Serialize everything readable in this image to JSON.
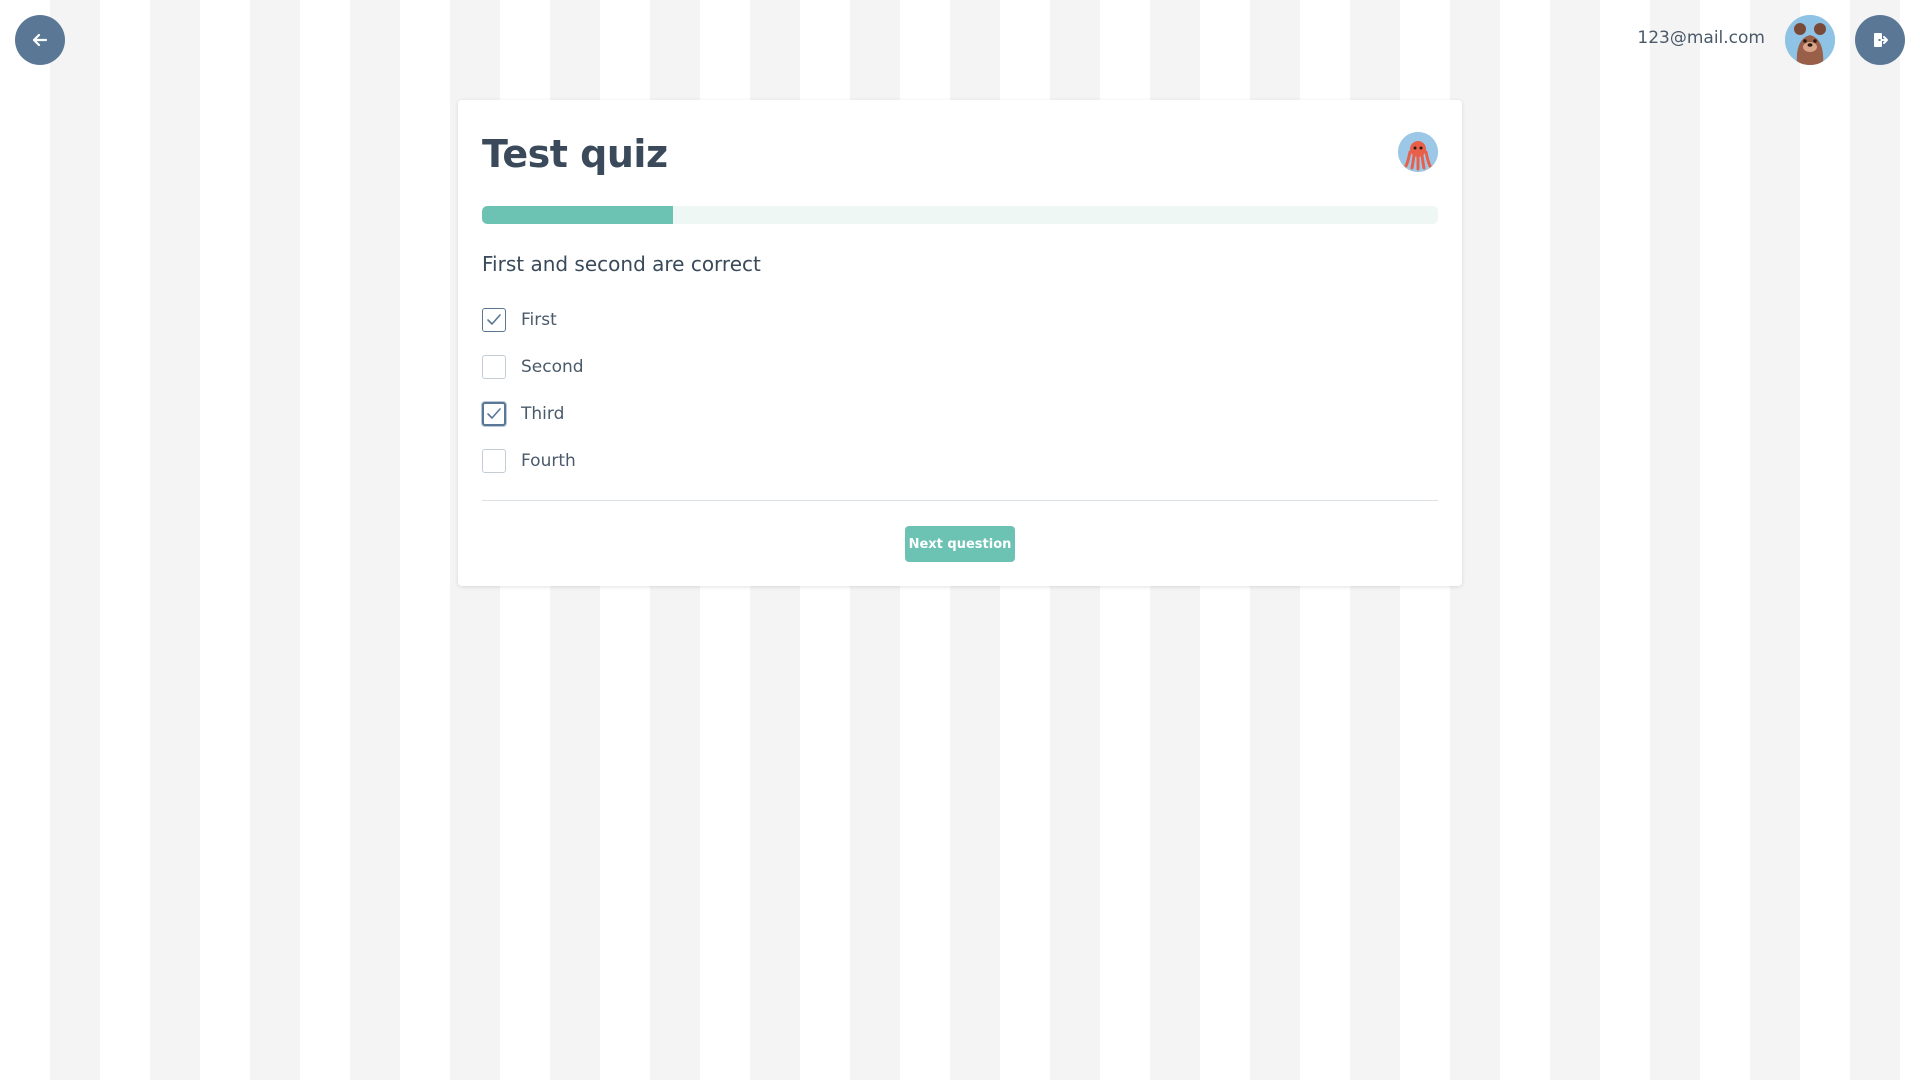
{
  "header": {
    "back_icon": "arrow-left-icon",
    "user_email": "123@mail.com",
    "user_avatar": "bear-avatar",
    "logout_icon": "logout-icon",
    "button_color": "#5a7896"
  },
  "quiz": {
    "title": "Test quiz",
    "avatar": "octopus-avatar",
    "progress": 0.2,
    "question": "First and second are correct",
    "options": [
      {
        "label": "First",
        "checked": true
      },
      {
        "label": "Second",
        "checked": false
      },
      {
        "label": "Third",
        "checked": true
      },
      {
        "label": "Fourth",
        "checked": false
      }
    ],
    "next_label": "Next question",
    "accent_color": "#6cc3b3"
  }
}
